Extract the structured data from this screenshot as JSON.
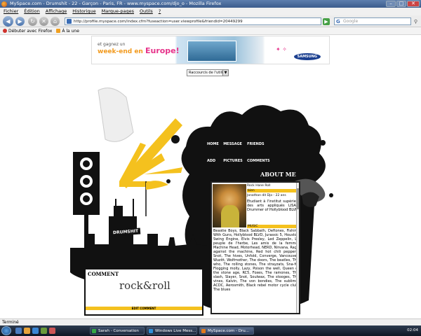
{
  "window": {
    "title": "MySpace.com - Drumshit - 22 - Garçon - Paris, FR - www.myspace.com/djo_o - Mozilla Firefox"
  },
  "menu": [
    "Fichier",
    "Édition",
    "Affichage",
    "Historique",
    "Marque-pages",
    "Outils",
    "?"
  ],
  "navbar": {
    "url": "http://profile.myspace.com/index.cfm?fuseaction=user.viewprofile&friendid=20449299",
    "search_placeholder": "Google"
  },
  "bookmarks": [
    {
      "label": "Débuter avec Firefox",
      "color": "#d0322d"
    },
    {
      "label": "À la une",
      "color": "#f0a020"
    }
  ],
  "ad": {
    "line1": "et gagnez un",
    "line2": "week-end en",
    "line2_em": "Europe!",
    "brand": "SAMSUNG"
  },
  "dropdown": {
    "value": "Raccourcis de l'utilis"
  },
  "profile_nav": [
    "HOME",
    "MESSAGE",
    "FRIENDS",
    "ADD",
    "PICTURES",
    "COMMENTS"
  ],
  "about_title": "ABOUT ME",
  "logo_text": "DRUMSHIT",
  "profile": {
    "name": "Rock Hane Roll",
    "tag1": "bien",
    "meta": "Jonathan dit Djo - 22 ans",
    "intro": "Etudiant à l'institut supérieur des arts appliqués LISAA. Drummer of Hollyblood BLVD.",
    "music_label": "MUSIC",
    "music": "Beastie Boys, Black Sabbath, Deftones, Fishing With Guns, Hollyblood BLVD, Jurassic 5, Houston Swing Engine, Elvis Presley, Led Zeppelin, Le peuple de l'herbe, Les amis de la femme, Machine Head, Motorhead, NERD, Nirvana, Rage against the machine, Red hot chili peppers, Snot, The hives, Unfold, Converge, Vancouver, Wuzitt, Wolfmother, The doors, The beatles, The who, The rolling stones, The strayzats, Sna-fu, Flogging molly, Lazy, Poison the well, Queen of the stone age, RC5, Foxes, The ramones, The slash, Slayer, Snot, Soulwax, The stooges, The vines, Kalvin, The von bondies, The sublime, ACDC, Aerosmith, Black rebel motor cycle club, The blues"
  },
  "comment": {
    "title": "COMMENT",
    "body": "rock&roll",
    "edit": "EDIT COMMENT"
  },
  "status": "Terminé",
  "taskbar": {
    "tasks": [
      {
        "label": "Sarah - Conversation",
        "color": "#36a845",
        "active": false
      },
      {
        "label": "Windows Live Mess...",
        "color": "#2f8fd8",
        "active": false
      },
      {
        "label": "MySpace.com - Dru...",
        "color": "#e07a1c",
        "active": true
      }
    ],
    "clock": "02:04"
  }
}
